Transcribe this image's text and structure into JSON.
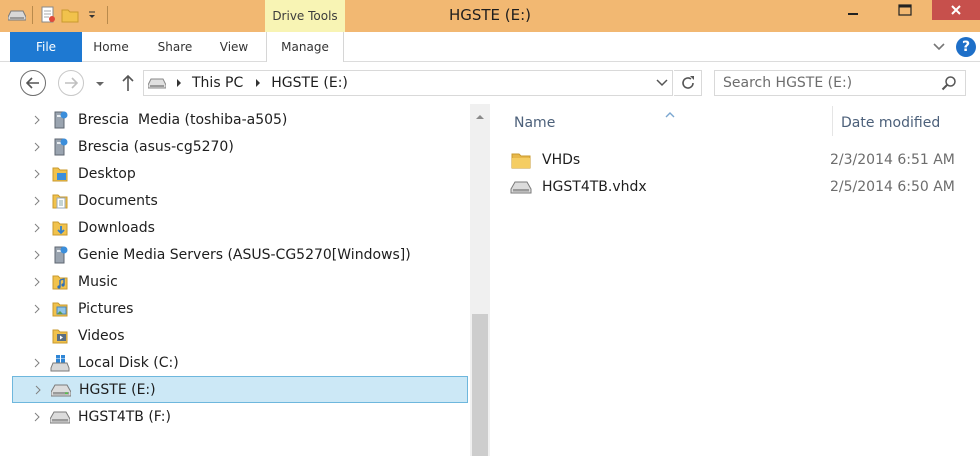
{
  "window": {
    "title": "HGSTE (E:)"
  },
  "colors": {
    "titlebar": "#f2b872",
    "drive_tools_tab": "#f8f4b4",
    "file_tab": "#1e79d2",
    "selection": "#cce8f6",
    "close_button": "#c7504c"
  },
  "ribbon": {
    "context_tab_label": "Drive Tools",
    "tabs": [
      {
        "label": "File"
      },
      {
        "label": "Home"
      },
      {
        "label": "Share"
      },
      {
        "label": "View"
      },
      {
        "label": "Manage"
      }
    ],
    "help_label": "?"
  },
  "address": {
    "crumbs": [
      "This PC",
      "HGSTE (E:)"
    ]
  },
  "search": {
    "placeholder": "Search HGSTE (E:)"
  },
  "nav_tree": [
    {
      "label": "Brescia  Media (toshiba-a505)",
      "icon": "media-server-icon",
      "expandable": true
    },
    {
      "label": "Brescia (asus-cg5270)",
      "icon": "media-server-icon",
      "expandable": true
    },
    {
      "label": "Desktop",
      "icon": "desktop-folder-icon",
      "expandable": true
    },
    {
      "label": "Documents",
      "icon": "documents-folder-icon",
      "expandable": true
    },
    {
      "label": "Downloads",
      "icon": "downloads-folder-icon",
      "expandable": true
    },
    {
      "label": "Genie Media Servers (ASUS-CG5270[Windows])",
      "icon": "media-server-icon",
      "expandable": true
    },
    {
      "label": "Music",
      "icon": "music-folder-icon",
      "expandable": true
    },
    {
      "label": "Pictures",
      "icon": "pictures-folder-icon",
      "expandable": true
    },
    {
      "label": "Videos",
      "icon": "videos-folder-icon",
      "expandable": false
    },
    {
      "label": "Local Disk (C:)",
      "icon": "windows-drive-icon",
      "expandable": true
    },
    {
      "label": "HGSTE (E:)",
      "icon": "drive-icon",
      "expandable": true,
      "selected": true
    },
    {
      "label": "HGST4TB (F:)",
      "icon": "drive-icon",
      "expandable": true
    }
  ],
  "content": {
    "columns": {
      "name": "Name",
      "date": "Date modified"
    },
    "files": [
      {
        "name": "VHDs",
        "date": "2/3/2014 6:51 AM",
        "icon": "folder-icon"
      },
      {
        "name": "HGST4TB.vhdx",
        "date": "2/5/2014 6:50 AM",
        "icon": "virtual-disk-icon"
      }
    ]
  }
}
